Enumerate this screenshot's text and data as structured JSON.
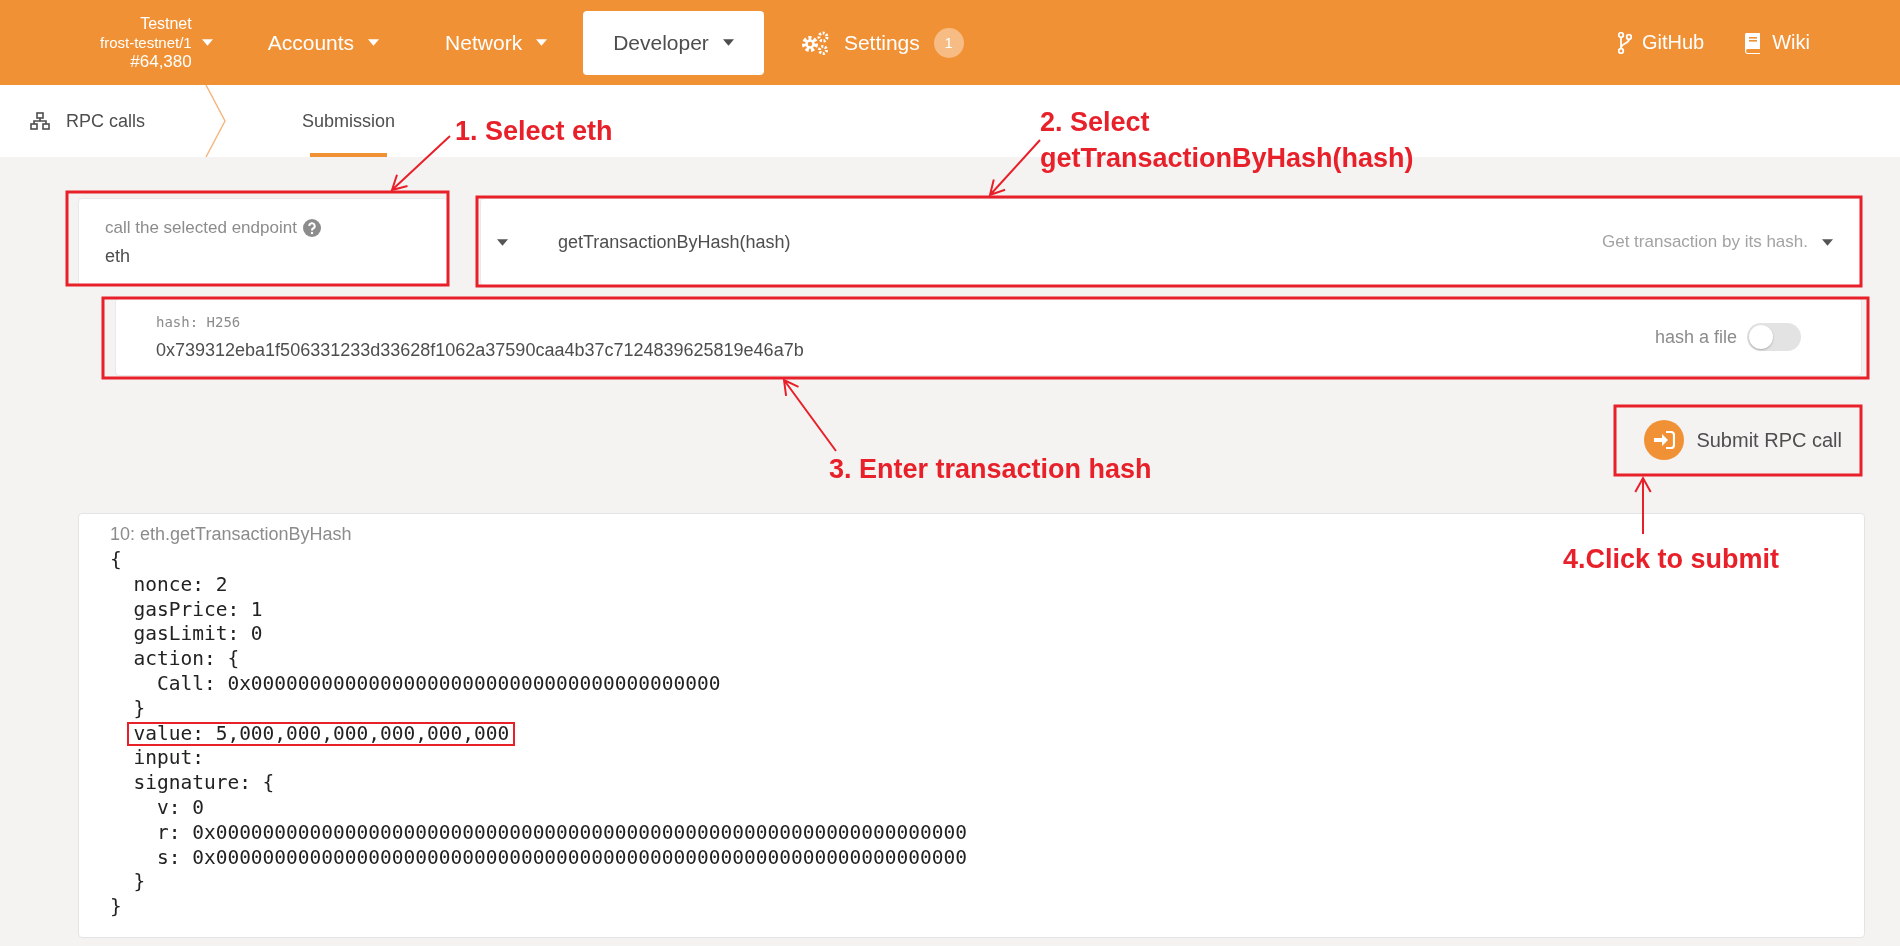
{
  "topbar": {
    "chain": {
      "name": "Testnet",
      "node": "frost-testnet/1",
      "block": "#64,380"
    },
    "menu": [
      {
        "label": "Accounts",
        "kind": "dropdown",
        "selected": false
      },
      {
        "label": "Network",
        "kind": "dropdown",
        "selected": false
      },
      {
        "label": "Developer",
        "kind": "dropdown",
        "selected": true
      },
      {
        "label": "Settings",
        "kind": "gear",
        "badge": "1",
        "selected": false
      }
    ],
    "links": [
      {
        "label": "GitHub",
        "kind": "branch"
      },
      {
        "label": "Wiki",
        "kind": "book"
      }
    ]
  },
  "tabs": [
    {
      "label": "RPC calls",
      "selected": false
    },
    {
      "label": "Submission",
      "selected": true
    }
  ],
  "endpoint": {
    "label": "call the selected endpoint",
    "value": "eth"
  },
  "method": {
    "value": "getTransactionByHash(hash)",
    "description": "Get transaction by its hash."
  },
  "param": {
    "label": "hash: H256",
    "value": "0x739312eba1f506331233d33628f1062a37590caa4b37c7124839625819e46a7b",
    "hash_file": {
      "label": "hash a file",
      "on": false
    }
  },
  "submit": {
    "label": "Submit RPC call"
  },
  "result": {
    "title": "10: eth.getTransactionByHash",
    "lines": [
      {
        "text": "{",
        "children": [
          {
            "text": "nonce: 2"
          },
          {
            "text": "gasPrice: 1"
          },
          {
            "text": "gasLimit: 0"
          },
          {
            "text": "action: {",
            "children": [
              {
                "text": "Call: 0x0000000000000000000000000000000000000000"
              }
            ]
          },
          {
            "text": "}"
          },
          {
            "text": "value: 5,000,000,000,000,000,000",
            "boxed": true
          },
          {
            "text": "input:"
          },
          {
            "text": "signature: {",
            "children": [
              {
                "text": "v: 0"
              },
              {
                "text": "r: 0x0000000000000000000000000000000000000000000000000000000000000000"
              },
              {
                "text": "s: 0x0000000000000000000000000000000000000000000000000000000000000000"
              }
            ]
          },
          {
            "text": "}"
          }
        ]
      },
      {
        "text": "}"
      }
    ]
  },
  "annotations": [
    {
      "text": "1. Select eth"
    },
    {
      "text": "2. Select getTransactionByHash(hash)"
    },
    {
      "text": "3. Enter transaction hash"
    },
    {
      "text": "4.Click to submit"
    }
  ]
}
